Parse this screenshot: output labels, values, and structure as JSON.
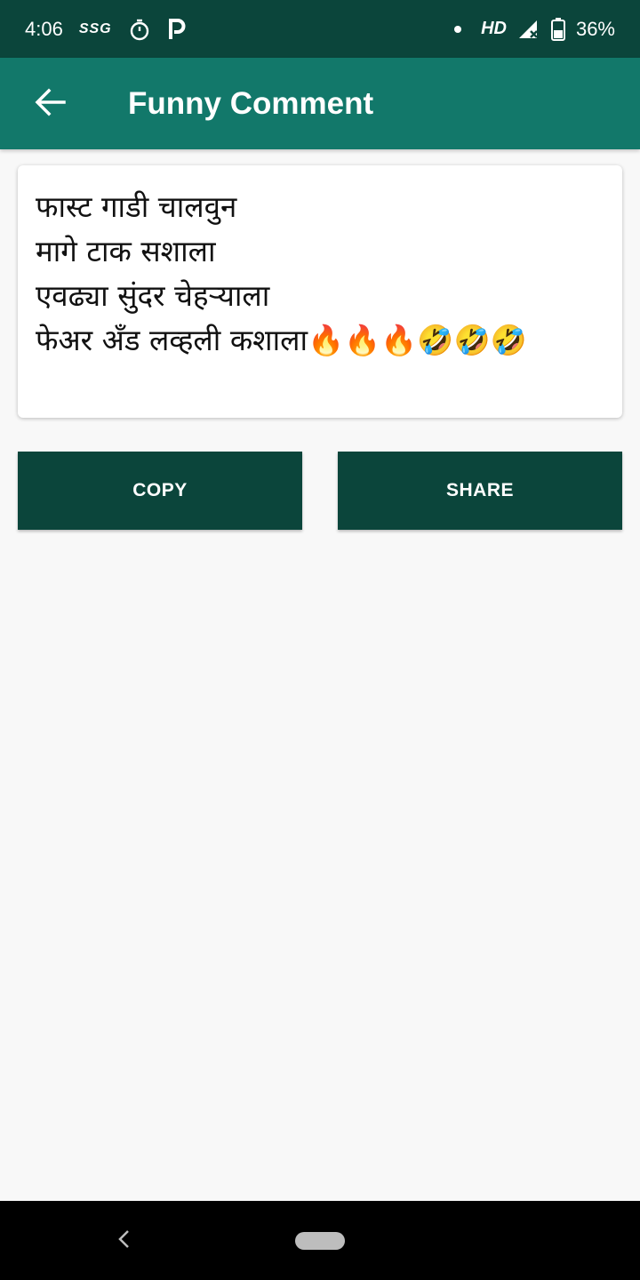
{
  "status_bar": {
    "time": "4:06",
    "carrier_label": "SSG",
    "network_label": "HD",
    "battery_percent": "36%"
  },
  "app_bar": {
    "title": "Funny Comment",
    "background": "#12786a"
  },
  "comment": {
    "text": "फास्ट गाडी चालवुन\nमागे टाक सशाला\nएवढ्या सुंदर चेहऱ्याला\nफेअर अँड लव्हली कशाला🔥🔥🔥🤣🤣🤣"
  },
  "actions": {
    "copy_label": "COPY",
    "share_label": "SHARE",
    "button_color": "#0b453b"
  },
  "icons": {
    "back": "arrow-left-icon",
    "timer": "stopwatch-icon",
    "parking": "p-icon",
    "signal": "signal-icon",
    "battery": "battery-icon",
    "nav_back": "chevron-left-icon",
    "nav_home": "home-pill-icon"
  }
}
